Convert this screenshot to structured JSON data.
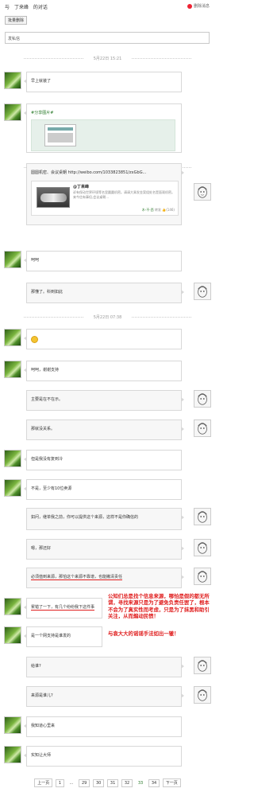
{
  "header": {
    "prefix": "与",
    "name": "丁来峰",
    "suffix": "的对话",
    "delete_label": "删除消息"
  },
  "toolbar": {
    "clear_label": "批量删除"
  },
  "input": {
    "value": "发私信"
  },
  "timestamps": [
    "5月22日 15:21",
    "5月22日 07:48",
    "5月22日 07:38"
  ],
  "messages": [
    {
      "from": "me",
      "text": "早上就装了"
    },
    {
      "from": "me",
      "text": "#分享图片#"
    },
    {
      "from": "him",
      "text": "圆圆机密、会议桌朝 http://weibo.com/1033823851/zxGbG...",
      "link": "http://weibo.com/1033823851/zxGbG...",
      "card_user": "@丁来峰",
      "card_text": "诉有保动世界环境等名里圆圆机密。请请大乘发金案组处名是面观机密。来今信有事但,会议桌朝...",
      "card_author": "木-不-西",
      "card_repost": "转发",
      "card_likes": "(146)"
    },
    {
      "from": "me",
      "text": "呵呵"
    },
    {
      "from": "him",
      "text": "那懂了。科到如此"
    },
    {
      "from": "me",
      "text": ":)"
    },
    {
      "from": "me",
      "text": "呵呵，谢谢支持"
    },
    {
      "from": "him",
      "text": "主要是在不在示。"
    },
    {
      "from": "him",
      "text": "那就没关系。"
    },
    {
      "from": "me",
      "text": "但是我没有复到冷"
    },
    {
      "from": "me",
      "text": "不是，至少有10位卖源"
    },
    {
      "from": "him",
      "text": "如问，继单我之前，你可以提供这个来源，这样不是你确信的"
    },
    {
      "from": "him",
      "text": "嗯，那还好"
    },
    {
      "from": "him",
      "text": "必须值到来源，那怕这个来源不靠谱，也能撇清责任"
    },
    {
      "from": "me",
      "text": "累错了一下，有几个纷纷我下这件事"
    },
    {
      "from": "me",
      "text": "是一个网支持是谁发的"
    },
    {
      "from": "him",
      "text": "给谁?"
    },
    {
      "from": "him",
      "text": "来源是谁儿?"
    },
    {
      "from": "me",
      "text": "我知道心里来"
    },
    {
      "from": "me",
      "text": "实知让大师"
    }
  ],
  "annotation": {
    "lines": [
      "公知们总是找个信息来源，哪怕是假的都无所谓，寻找来源只是为了避免负责任罢了，根本不会为了真实性而考虑，只是为了抹黑和助引关注，从而煽动民愤！",
      "与袁大大的谣谣手法如出一辙！"
    ]
  },
  "pagination": {
    "prev": "上一页",
    "pages": [
      "1",
      "...",
      "29",
      "30",
      "31",
      "32",
      "33",
      "34"
    ],
    "current": "33",
    "next": "下一页"
  },
  "colors": {
    "accent_green": "#2a7a2a",
    "annotation_red": "#e02020"
  }
}
